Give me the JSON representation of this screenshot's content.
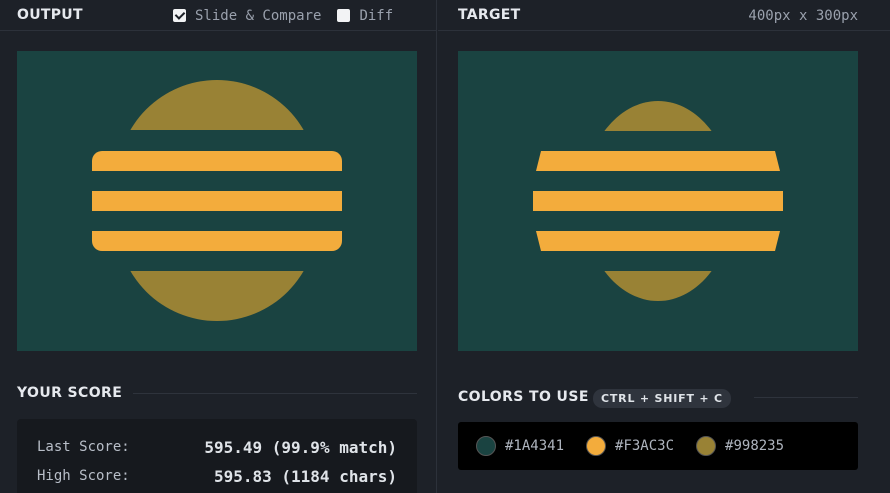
{
  "output": {
    "title": "OUTPUT",
    "slide_compare_label": "Slide & Compare",
    "slide_compare_checked": true,
    "diff_label": "Diff",
    "diff_checked": false
  },
  "target": {
    "title": "TARGET",
    "dimensions": "400px x 300px"
  },
  "score": {
    "heading": "YOUR SCORE",
    "last_label": "Last Score:",
    "last_value": "595.49 (99.9% match)",
    "high_label": "High Score:",
    "high_value": "595.83 (1184 chars)"
  },
  "colors": {
    "heading": "COLORS TO USE",
    "shortcut": "CTRL + SHIFT + C",
    "items": [
      {
        "hex": "#1A4341",
        "color": "#1a4341"
      },
      {
        "hex": "#F3AC3C",
        "color": "#f3ac3c"
      },
      {
        "hex": "#998235",
        "color": "#998235"
      }
    ]
  }
}
